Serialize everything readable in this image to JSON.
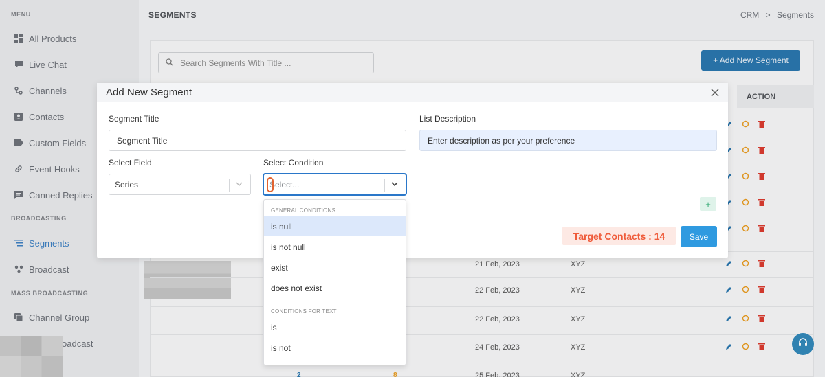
{
  "sidebar": {
    "section_menu": "MENU",
    "section_broadcasting": "BROADCASTING",
    "section_mass": "MASS BROADCASTING",
    "items": [
      {
        "label": "All Products",
        "icon": "grid-icon"
      },
      {
        "label": "Live Chat",
        "icon": "chat-icon"
      },
      {
        "label": "Channels",
        "icon": "channels-icon"
      },
      {
        "label": "Contacts",
        "icon": "contacts-icon"
      },
      {
        "label": "Custom Fields",
        "icon": "tag-icon"
      },
      {
        "label": "Event Hooks",
        "icon": "link-icon"
      },
      {
        "label": "Canned Replies",
        "icon": "message-icon"
      },
      {
        "label": "Segments",
        "icon": "segments-icon"
      },
      {
        "label": "Broadcast",
        "icon": "broadcast-icon"
      },
      {
        "label": "Channel Group",
        "icon": "channel-group-icon"
      },
      {
        "label": "oadcast",
        "icon": ""
      }
    ],
    "active_item": "Segments"
  },
  "header": {
    "title": "SEGMENTS",
    "breadcrumb_root": "CRM",
    "breadcrumb_sep": ">",
    "breadcrumb_current": "Segments"
  },
  "list": {
    "search_placeholder": "Search Segments With Title ...",
    "add_button": "+ Add New Segment",
    "action_header": "ACTION",
    "rows": [
      {
        "date": "21 Feb, 2023",
        "name": "XYZ"
      },
      {
        "date": "22 Feb, 2023",
        "name": "XYZ"
      },
      {
        "date": "22 Feb, 2023",
        "name": "XYZ"
      },
      {
        "date": "24 Feb, 2023",
        "name": "XYZ"
      },
      {
        "date": "25 Feb, 2023",
        "name": "XYZ"
      }
    ],
    "partial_badges": [
      "2",
      "8"
    ]
  },
  "modal": {
    "title": "Add New Segment",
    "segment_title_label": "Segment Title",
    "segment_title_value": "Segment Title",
    "list_description_label": "List Description",
    "list_description_value": "Enter description as per your preference",
    "select_field_label": "Select Field",
    "select_field_value": "Series",
    "select_condition_label": "Select Condition",
    "select_condition_placeholder": "Select...",
    "plus_label": "+",
    "target_contacts": "Target Contacts : 14",
    "save_label": "Save"
  },
  "dropdown": {
    "group_general": "GENERAL CONDITIONS",
    "group_text": "CONDITIONS FOR TEXT",
    "options_general": [
      "is null",
      "is not null",
      "exist",
      "does not exist"
    ],
    "options_text": [
      "is",
      "is not"
    ],
    "highlighted": "is null"
  },
  "colors": {
    "accent": "#2774ad",
    "save": "#2f9ae0",
    "target_text": "#ef5b3a",
    "target_bg": "#fde9e4",
    "edit_icon": "#2774ad",
    "refresh_icon": "#e89a1c",
    "delete_icon": "#d9382c"
  }
}
